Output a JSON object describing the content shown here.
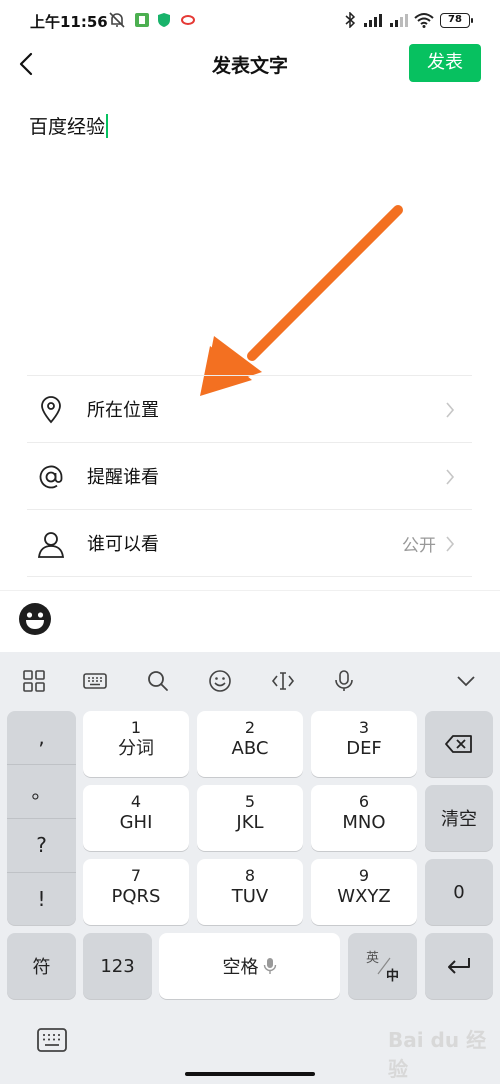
{
  "status_bar": {
    "time": "上午11:56",
    "battery": "78"
  },
  "header": {
    "title": "发表文字",
    "publish_label": "发表"
  },
  "compose": {
    "text": "百度经验"
  },
  "options": [
    {
      "label": "所在位置",
      "value": "",
      "icon": "location-pin-icon"
    },
    {
      "label": "提醒谁看",
      "value": "",
      "icon": "at-icon"
    },
    {
      "label": "谁可以看",
      "value": "公开",
      "icon": "person-icon"
    }
  ],
  "keyboard": {
    "punctuation": [
      ",",
      "。",
      "?",
      "!"
    ],
    "keys": [
      {
        "num": "1",
        "letters": "分词"
      },
      {
        "num": "2",
        "letters": "ABC"
      },
      {
        "num": "3",
        "letters": "DEF"
      },
      {
        "num": "4",
        "letters": "GHI"
      },
      {
        "num": "5",
        "letters": "JKL"
      },
      {
        "num": "6",
        "letters": "MNO"
      },
      {
        "num": "7",
        "letters": "PQRS"
      },
      {
        "num": "8",
        "letters": "TUV"
      },
      {
        "num": "9",
        "letters": "WXYZ"
      }
    ],
    "clear_label": "清空",
    "zero_label": "0",
    "symbol_label": "符",
    "numeric_label": "123",
    "space_label": "空格",
    "lang_en": "英",
    "lang_zh": "中"
  },
  "watermark": "Bai du 经验",
  "colors": {
    "accent": "#07c160",
    "arrow": "#f37021"
  }
}
